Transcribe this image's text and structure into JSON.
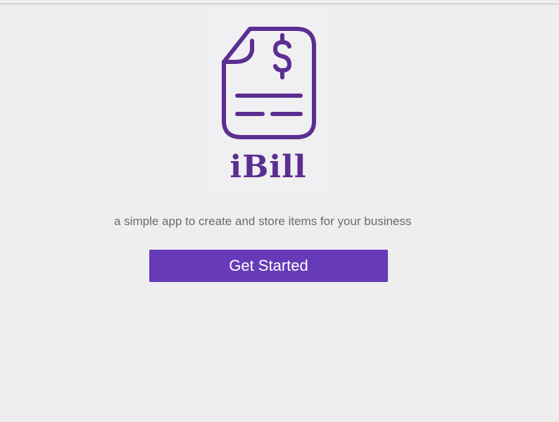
{
  "brand": {
    "logo_text": "iBill",
    "logo_icon": "invoice-dollar-icon",
    "accent_color": "#5b2e91"
  },
  "intro": {
    "tagline": "a simple app to create and store items for your business"
  },
  "actions": {
    "get_started_label": "Get Started",
    "button_color": "#673ab7"
  }
}
